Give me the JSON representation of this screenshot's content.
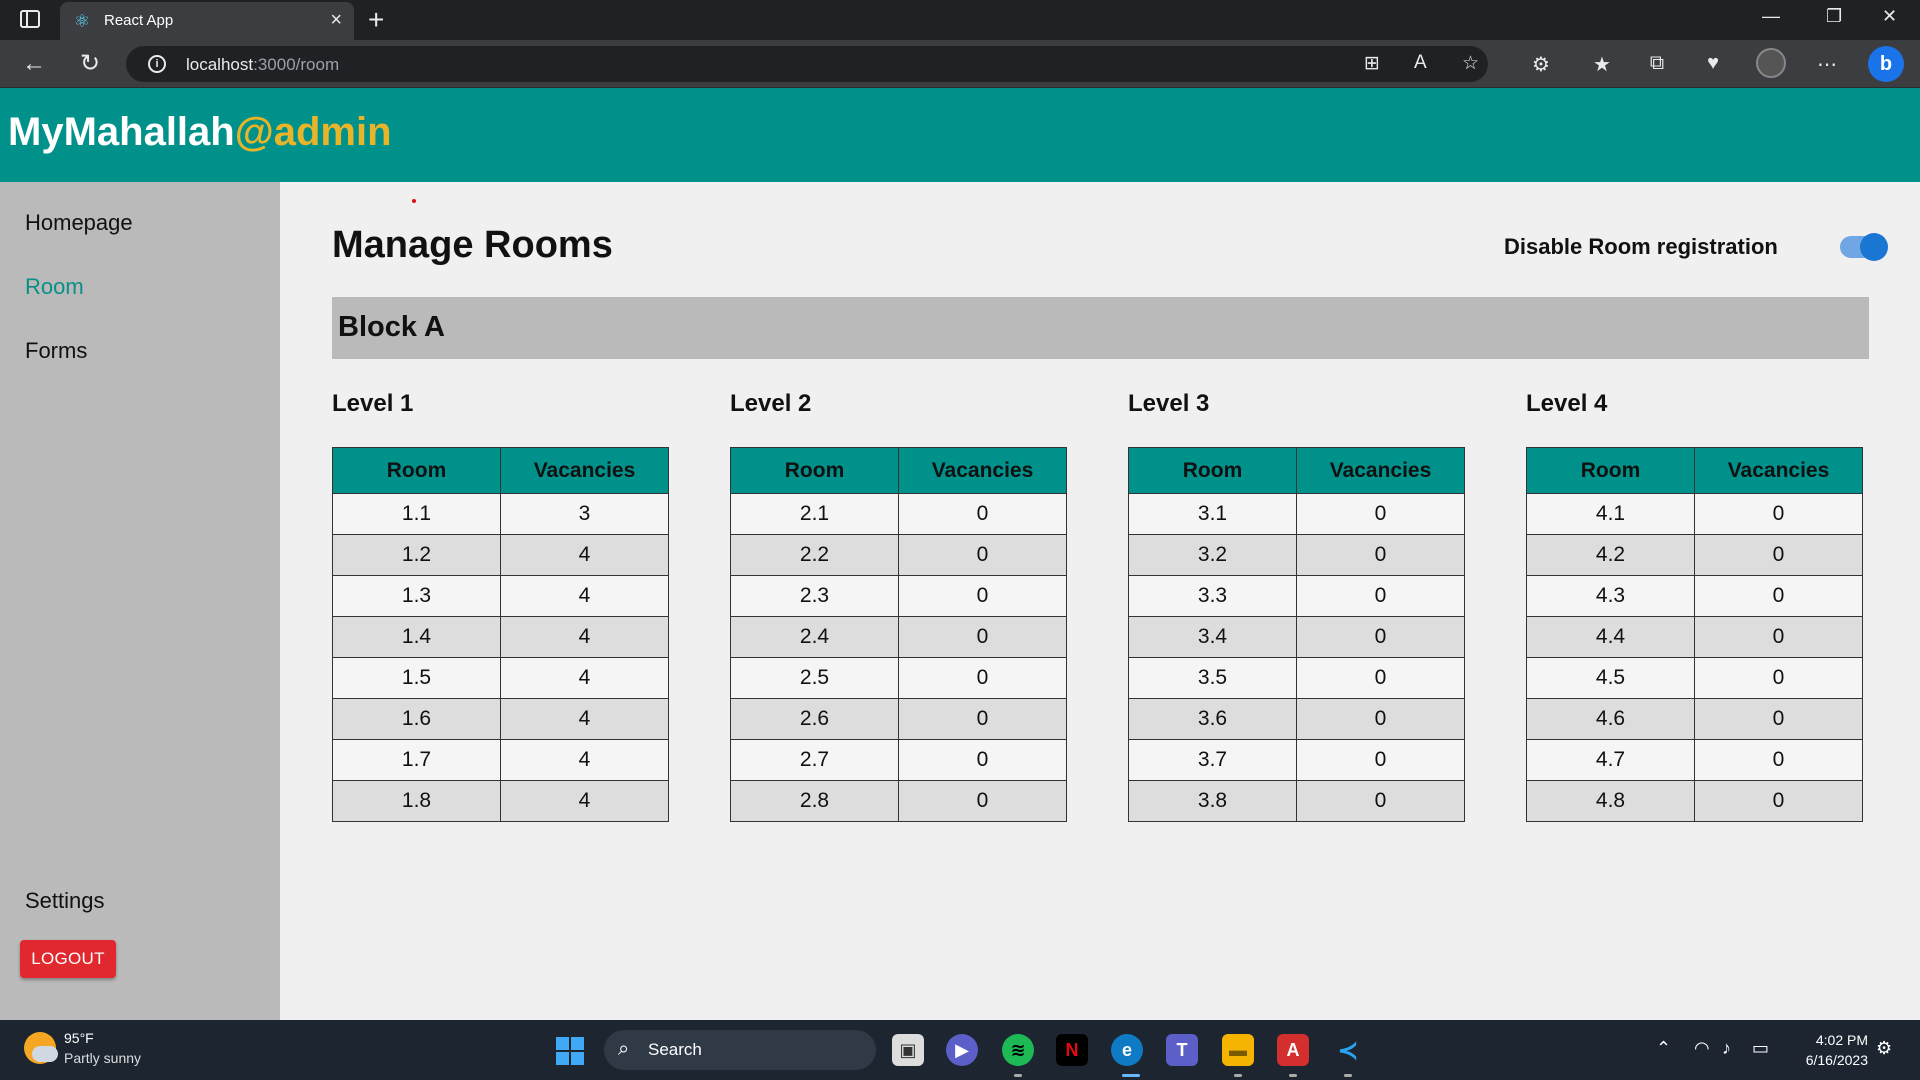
{
  "browser": {
    "tab_title": "React App",
    "url_host": "localhost",
    "url_rest": ":3000/room"
  },
  "app": {
    "brand_main": "MyMahallah",
    "brand_role": "@admin"
  },
  "sidenav": {
    "items": [
      {
        "label": "Homepage",
        "active": false
      },
      {
        "label": "Room",
        "active": true
      },
      {
        "label": "Forms",
        "active": false
      }
    ],
    "settings_label": "Settings",
    "logout_label": "LOGOUT"
  },
  "main": {
    "title": "Manage Rooms",
    "toggle_label": "Disable Room registration",
    "toggle_on": true,
    "block_title": "Block A",
    "col_room": "Room",
    "col_vacancies": "Vacancies",
    "levels": [
      {
        "name": "Level 1",
        "rooms": [
          [
            "1.1",
            "3"
          ],
          [
            "1.2",
            "4"
          ],
          [
            "1.3",
            "4"
          ],
          [
            "1.4",
            "4"
          ],
          [
            "1.5",
            "4"
          ],
          [
            "1.6",
            "4"
          ],
          [
            "1.7",
            "4"
          ],
          [
            "1.8",
            "4"
          ]
        ]
      },
      {
        "name": "Level 2",
        "rooms": [
          [
            "2.1",
            "0"
          ],
          [
            "2.2",
            "0"
          ],
          [
            "2.3",
            "0"
          ],
          [
            "2.4",
            "0"
          ],
          [
            "2.5",
            "0"
          ],
          [
            "2.6",
            "0"
          ],
          [
            "2.7",
            "0"
          ],
          [
            "2.8",
            "0"
          ]
        ]
      },
      {
        "name": "Level 3",
        "rooms": [
          [
            "3.1",
            "0"
          ],
          [
            "3.2",
            "0"
          ],
          [
            "3.3",
            "0"
          ],
          [
            "3.4",
            "0"
          ],
          [
            "3.5",
            "0"
          ],
          [
            "3.6",
            "0"
          ],
          [
            "3.7",
            "0"
          ],
          [
            "3.8",
            "0"
          ]
        ]
      },
      {
        "name": "Level 4",
        "rooms": [
          [
            "4.1",
            "0"
          ],
          [
            "4.2",
            "0"
          ],
          [
            "4.3",
            "0"
          ],
          [
            "4.4",
            "0"
          ],
          [
            "4.5",
            "0"
          ],
          [
            "4.6",
            "0"
          ],
          [
            "4.7",
            "0"
          ],
          [
            "4.8",
            "0"
          ]
        ]
      }
    ]
  },
  "taskbar": {
    "temperature": "95°F",
    "condition": "Partly sunny",
    "search_label": "Search",
    "time": "4:02 PM",
    "date": "6/16/2023"
  },
  "colors": {
    "header": "#00918a",
    "accent_text": "#e8b429",
    "active_nav": "#0a8f88",
    "logout": "#e0282e",
    "toggle": "#1976d2"
  }
}
